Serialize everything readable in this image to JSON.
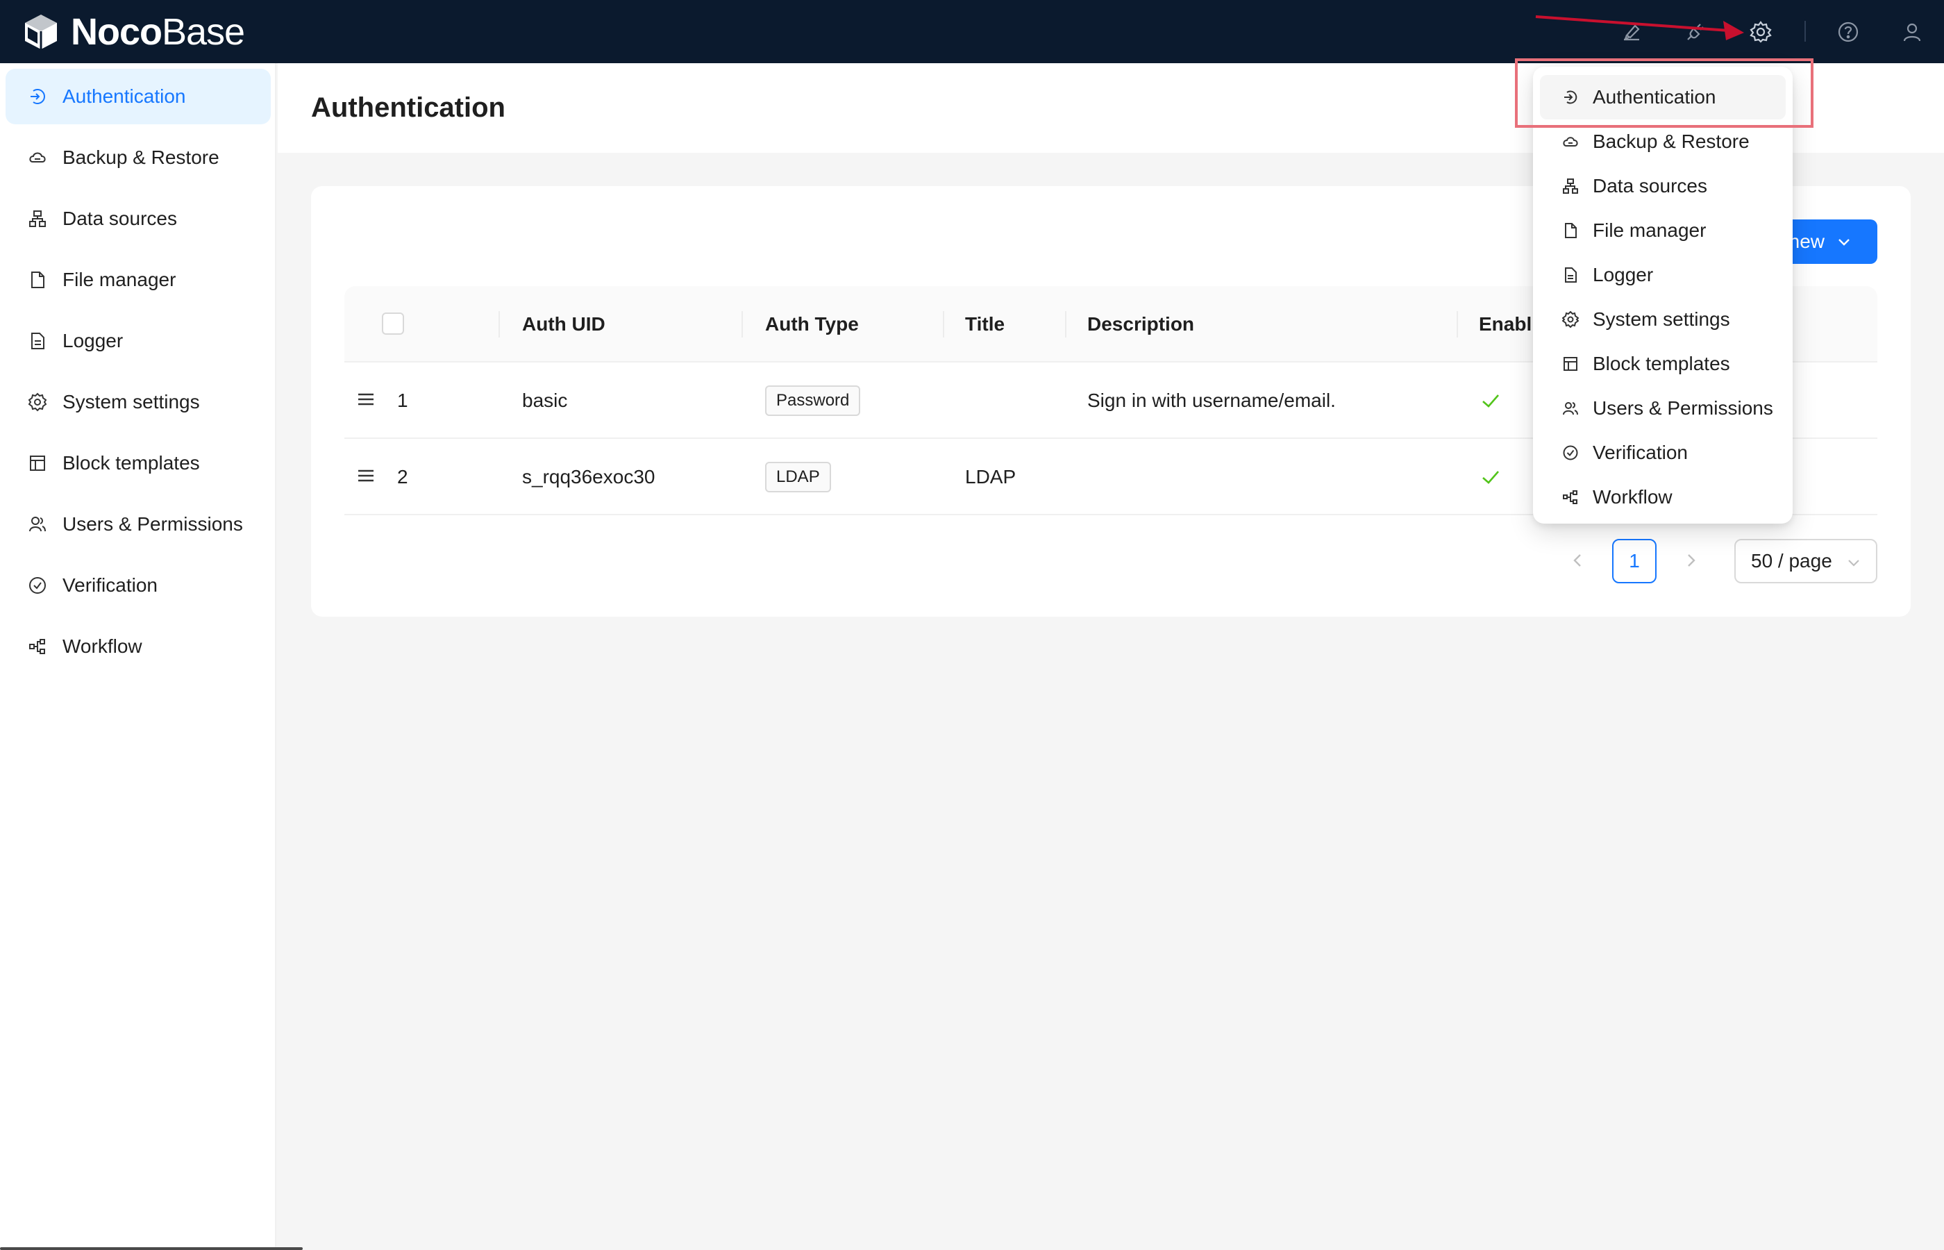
{
  "app": {
    "logo_bold": "Noco",
    "logo_light": "Base"
  },
  "topbar": {
    "icons": [
      "ui-editor-icon",
      "plugin-icon",
      "settings-gear-icon",
      "help-icon",
      "user-icon"
    ]
  },
  "sidebar": {
    "items": [
      {
        "label": "Authentication",
        "icon": "login-icon",
        "active": true
      },
      {
        "label": "Backup & Restore",
        "icon": "cloud-backup-icon",
        "active": false
      },
      {
        "label": "Data sources",
        "icon": "data-sources-icon",
        "active": false
      },
      {
        "label": "File manager",
        "icon": "file-icon",
        "active": false
      },
      {
        "label": "Logger",
        "icon": "log-file-icon",
        "active": false
      },
      {
        "label": "System settings",
        "icon": "gear-icon",
        "active": false
      },
      {
        "label": "Block templates",
        "icon": "layout-icon",
        "active": false
      },
      {
        "label": "Users & Permissions",
        "icon": "users-icon",
        "active": false
      },
      {
        "label": "Verification",
        "icon": "check-circle-icon",
        "active": false
      },
      {
        "label": "Workflow",
        "icon": "workflow-icon",
        "active": false
      }
    ]
  },
  "page": {
    "title": "Authentication",
    "add_button_label": "new"
  },
  "table": {
    "columns": [
      "Auth UID",
      "Auth Type",
      "Title",
      "Description",
      "Enabl"
    ],
    "rows": [
      {
        "index": "1",
        "uid": "basic",
        "type": "Password",
        "title": "",
        "description": "Sign in with username/email.",
        "enabled": true
      },
      {
        "index": "2",
        "uid": "s_rqq36exoc30",
        "type": "LDAP",
        "title": "LDAP",
        "description": "",
        "enabled": true
      }
    ]
  },
  "pagination": {
    "current_page": "1",
    "page_size": "50 / page"
  },
  "dropdown": {
    "items": [
      {
        "label": "Authentication",
        "icon": "login-icon",
        "hover": true
      },
      {
        "label": "Backup & Restore",
        "icon": "cloud-backup-icon"
      },
      {
        "label": "Data sources",
        "icon": "data-sources-icon"
      },
      {
        "label": "File manager",
        "icon": "file-icon"
      },
      {
        "label": "Logger",
        "icon": "log-file-icon"
      },
      {
        "label": "System settings",
        "icon": "gear-icon"
      },
      {
        "label": "Block templates",
        "icon": "layout-icon"
      },
      {
        "label": "Users & Permissions",
        "icon": "users-icon"
      },
      {
        "label": "Verification",
        "icon": "check-circle-icon"
      },
      {
        "label": "Workflow",
        "icon": "workflow-icon"
      }
    ]
  },
  "colors": {
    "topbar_bg": "#0b1a2e",
    "primary": "#1677ff",
    "active_bg": "#e6f4ff",
    "success": "#52c41a",
    "annotation": "#e8707a",
    "arrow": "#c8102e"
  }
}
